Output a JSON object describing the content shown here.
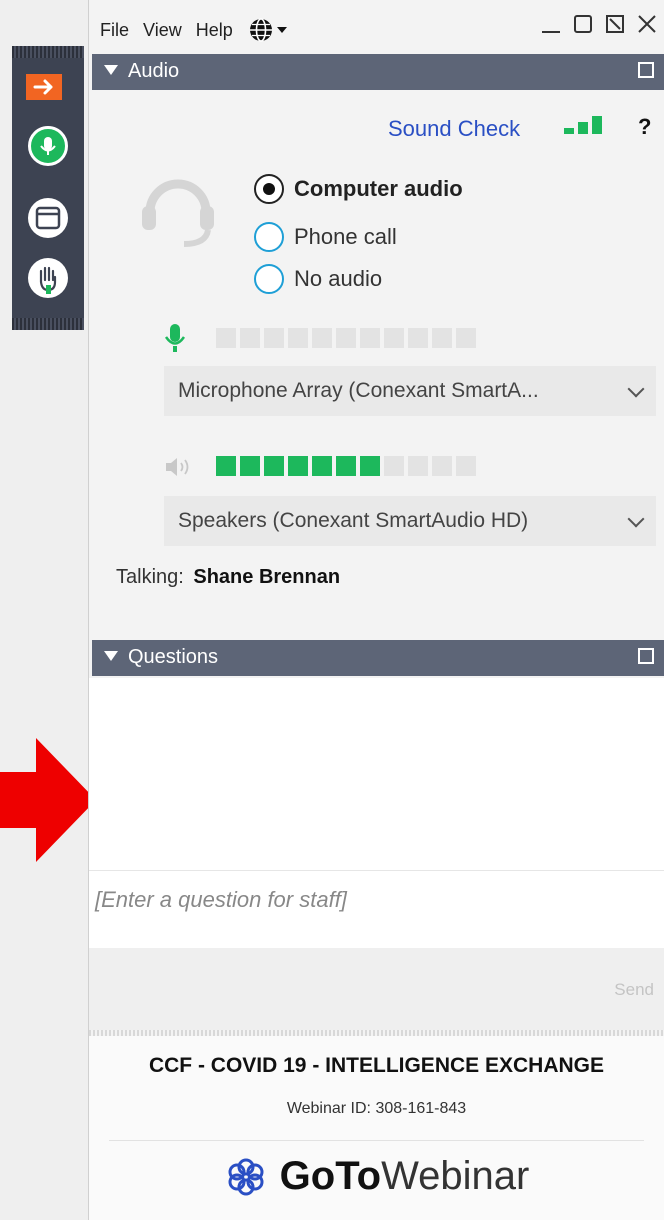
{
  "menu": {
    "file": "File",
    "view": "View",
    "help": "Help"
  },
  "audio": {
    "title": "Audio",
    "sound_check": "Sound Check",
    "help_mark": "?",
    "options": [
      "Computer audio",
      "Phone call",
      "No audio"
    ],
    "selected_option": "Computer audio",
    "mic_level": 0,
    "mic_segments": 11,
    "microphone_device": "Microphone Array (Conexant SmartA...",
    "speaker_level": 7,
    "speaker_segments": 11,
    "speaker_device": "Speakers (Conexant SmartAudio HD)",
    "talking_label": "Talking:",
    "talking_name": "Shane Brennan"
  },
  "questions": {
    "title": "Questions",
    "input_placeholder": "[Enter a question for staff]",
    "send_label": "Send"
  },
  "webinar": {
    "title": "CCF - COVID 19 - INTELLIGENCE EXCHANGE",
    "id_text": "Webinar ID: 308-161-843",
    "brand_bold": "GoTo",
    "brand_light": "Webinar"
  },
  "colors": {
    "accent_blue": "#2a4fc4",
    "meter_green": "#1db85c",
    "header_gray": "#5d6577",
    "toolbar_dark": "#3d4352",
    "arrow_red": "#ee0000",
    "arrow_orange": "#f26522"
  },
  "icons": [
    "arrow-right-icon",
    "microphone-icon",
    "window-icon",
    "raise-hand-icon",
    "globe-icon",
    "headset-icon",
    "speaker-icon",
    "signal-bars-icon",
    "popout-icon",
    "logo-icon"
  ]
}
